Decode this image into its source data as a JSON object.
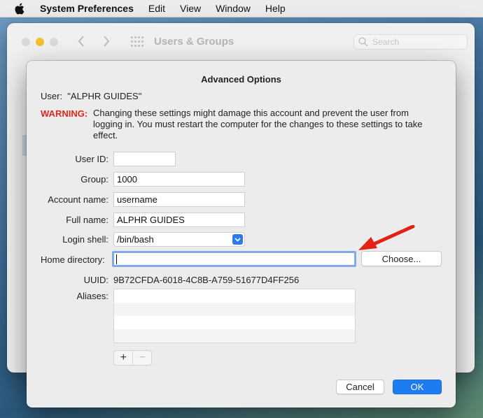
{
  "menubar": {
    "app_name": "System Preferences",
    "items": [
      "Edit",
      "View",
      "Window",
      "Help"
    ]
  },
  "window": {
    "title": "Users & Groups",
    "search_placeholder": "Search"
  },
  "dialog": {
    "title": "Advanced Options",
    "user_line": "User:  \"ALPHR GUIDES\"",
    "warning_label": "WARNING:",
    "warning_text": "Changing these settings might damage this account and prevent the user from logging in. You must restart the computer for the changes to these settings to take effect.",
    "fields": {
      "user_id": {
        "label": "User ID:",
        "value": ""
      },
      "group": {
        "label": "Group:",
        "value": "1000"
      },
      "account_name": {
        "label": "Account name:",
        "value": "username"
      },
      "full_name": {
        "label": "Full name:",
        "value": "ALPHR GUIDES"
      },
      "login_shell": {
        "label": "Login shell:",
        "value": "/bin/bash"
      },
      "home_directory": {
        "label": "Home directory:",
        "value": ""
      },
      "uuid": {
        "label": "UUID:",
        "value": "9B72CFDA-6018-4C8B-A759-51677D4FF256"
      },
      "aliases": {
        "label": "Aliases:"
      }
    },
    "choose_button": "Choose...",
    "add_button": "+",
    "remove_button": "−",
    "cancel_button": "Cancel",
    "ok_button": "OK"
  },
  "colors": {
    "warning": "#e0271b",
    "accent": "#1e7cf2",
    "annotation_arrow": "#e32216",
    "focus_ring": "#7fa9e8"
  },
  "icons": [
    "apple-icon",
    "chevron-left-icon",
    "chevron-right-icon",
    "grid-icon",
    "search-icon",
    "chevron-updown-icon",
    "red-arrow-annotation"
  ]
}
